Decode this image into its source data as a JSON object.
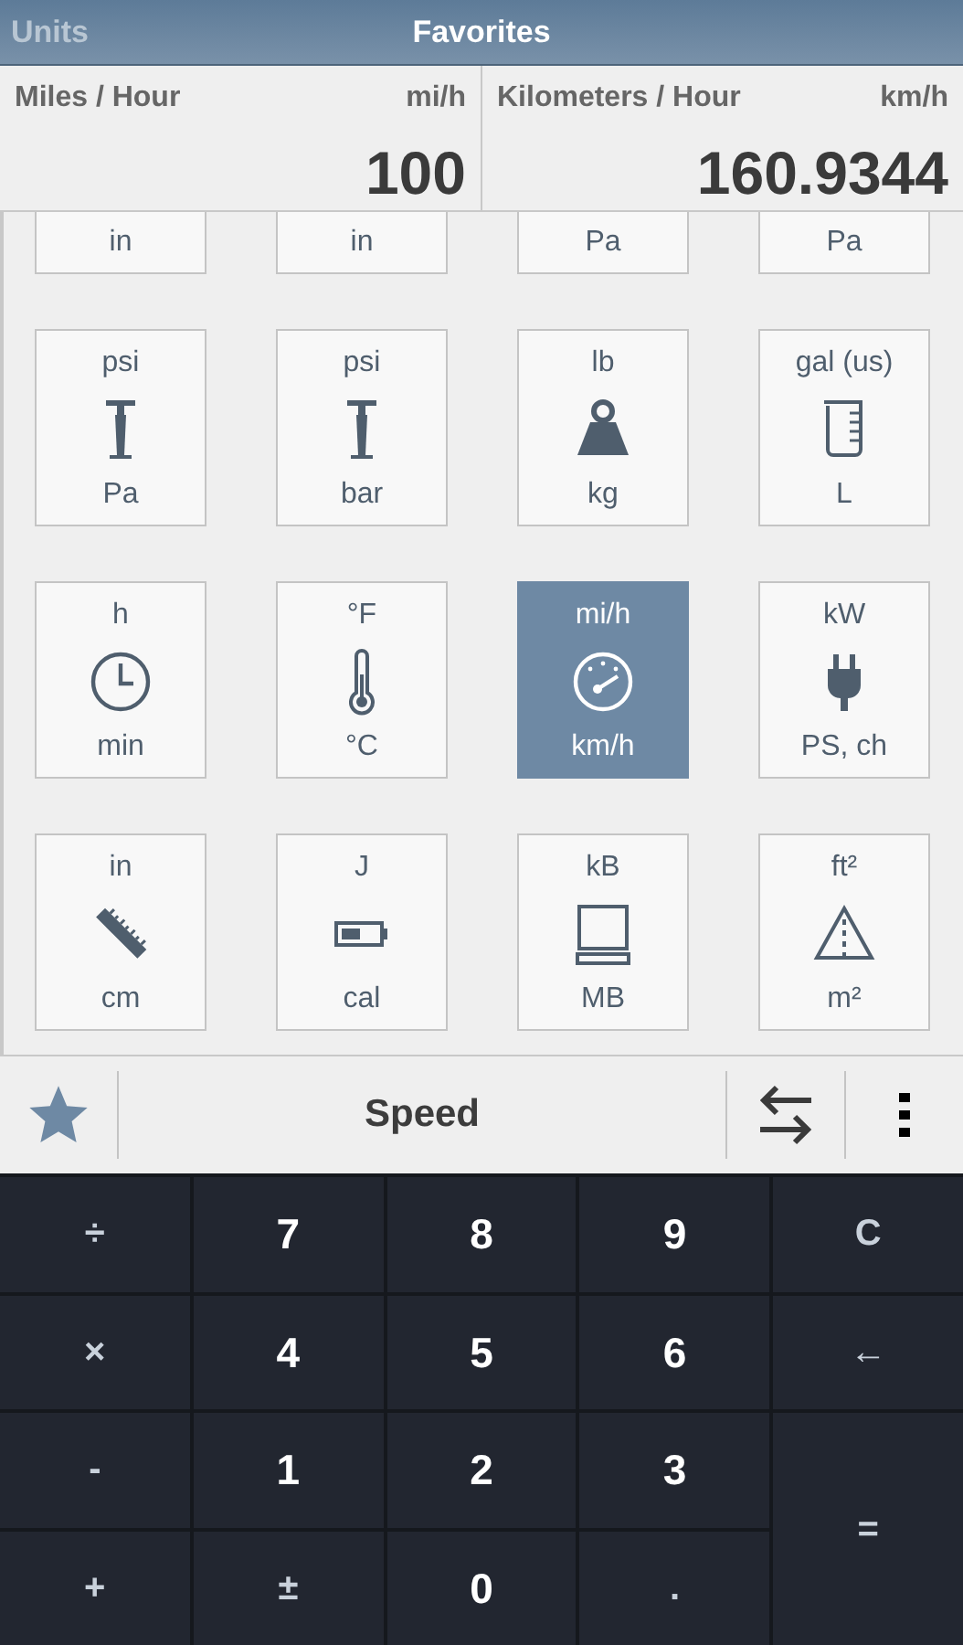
{
  "tabs": [
    {
      "label": "Units",
      "selected": false
    },
    {
      "label": "Favorites",
      "selected": true
    }
  ],
  "display": [
    {
      "name": "Miles / Hour",
      "unit": "mi/h",
      "value": "100"
    },
    {
      "name": "Kilometers / Hour",
      "unit": "km/h",
      "value": "160.9344"
    }
  ],
  "partial_row": [
    {
      "bottom": "in"
    },
    {
      "bottom": "in"
    },
    {
      "bottom": "Pa"
    },
    {
      "bottom": "Pa"
    }
  ],
  "tiles": [
    {
      "top": "psi",
      "bottom": "Pa",
      "kind": "pump",
      "selected": false
    },
    {
      "top": "psi",
      "bottom": "bar",
      "kind": "pump",
      "selected": false
    },
    {
      "top": "lb",
      "bottom": "kg",
      "kind": "weight",
      "selected": false
    },
    {
      "top": "gal (us)",
      "bottom": "L",
      "kind": "beaker",
      "selected": false
    },
    {
      "top": "h",
      "bottom": "min",
      "kind": "clock",
      "selected": false
    },
    {
      "top": "°F",
      "bottom": "°C",
      "kind": "thermometer",
      "selected": false
    },
    {
      "top": "mi/h",
      "bottom": "km/h",
      "kind": "gauge",
      "selected": true
    },
    {
      "top": "kW",
      "bottom": "PS, ch",
      "kind": "plug",
      "selected": false
    },
    {
      "top": "in",
      "bottom": "cm",
      "kind": "ruler",
      "selected": false
    },
    {
      "top": "J",
      "bottom": "cal",
      "kind": "battery",
      "selected": false
    },
    {
      "top": "kB",
      "bottom": "MB",
      "kind": "monitor",
      "selected": false
    },
    {
      "top": "ft²",
      "bottom": "m²",
      "kind": "triangle",
      "selected": false
    }
  ],
  "toolbar": {
    "title": "Speed",
    "favorite": true
  },
  "keypad": [
    {
      "label": "÷",
      "kind": "op"
    },
    {
      "label": "7",
      "kind": "digit"
    },
    {
      "label": "8",
      "kind": "digit"
    },
    {
      "label": "9",
      "kind": "digit"
    },
    {
      "label": "C",
      "kind": "op"
    },
    {
      "label": "×",
      "kind": "op"
    },
    {
      "label": "4",
      "kind": "digit"
    },
    {
      "label": "5",
      "kind": "digit"
    },
    {
      "label": "6",
      "kind": "digit"
    },
    {
      "label": "←",
      "kind": "op"
    },
    {
      "label": "-",
      "kind": "op"
    },
    {
      "label": "1",
      "kind": "digit"
    },
    {
      "label": "2",
      "kind": "digit"
    },
    {
      "label": "3",
      "kind": "digit"
    },
    {
      "label": "=",
      "kind": "equals"
    },
    {
      "label": "+",
      "kind": "op"
    },
    {
      "label": "±",
      "kind": "op"
    },
    {
      "label": "0",
      "kind": "digit"
    },
    {
      "label": ".",
      "kind": "op"
    }
  ]
}
